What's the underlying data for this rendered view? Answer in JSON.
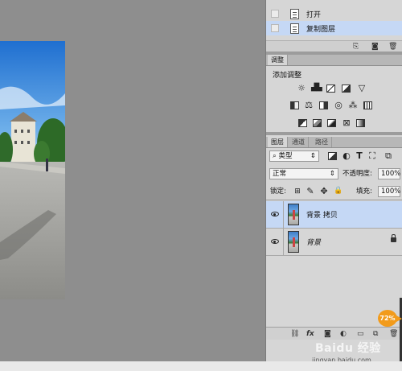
{
  "history": {
    "items": [
      {
        "label": "打开",
        "selected": false
      },
      {
        "label": "复制图层",
        "selected": true
      }
    ]
  },
  "adjustments": {
    "tab": "调整",
    "title": "添加调整",
    "icons_row1": [
      "brightness-icon",
      "levels-icon",
      "curves-icon",
      "exposure-icon",
      "vibrance-icon"
    ],
    "icons_row2": [
      "hue-saturation-icon",
      "color-balance-icon",
      "black-white-icon",
      "photo-filter-icon",
      "channel-mixer-icon",
      "color-lookup-icon"
    ],
    "icons_row3": [
      "invert-icon",
      "posterize-icon",
      "threshold-icon",
      "selective-color-icon",
      "gradient-map-icon"
    ]
  },
  "layers_panel": {
    "tabs": [
      "图层",
      "通道",
      "路径"
    ],
    "filter_kind": "类型",
    "blend_mode": "正常",
    "opacity_label": "不透明度:",
    "opacity_value": "100%",
    "lock_label": "锁定:",
    "fill_label": "填充:",
    "fill_value": "100%",
    "layers": [
      {
        "name": "背景 拷贝",
        "selected": true,
        "locked": false
      },
      {
        "name": "背景",
        "selected": false,
        "locked": true
      }
    ]
  },
  "zoom_badge": "72%",
  "watermark": {
    "logo": "Baidu 经验",
    "url": "jingyan.baidu.com"
  },
  "colors": {
    "selected_row": "#c5d8f5",
    "panel_bg": "#d6d6d6",
    "canvas_bg": "#8e8e8e",
    "badge": "#f29b1b"
  }
}
